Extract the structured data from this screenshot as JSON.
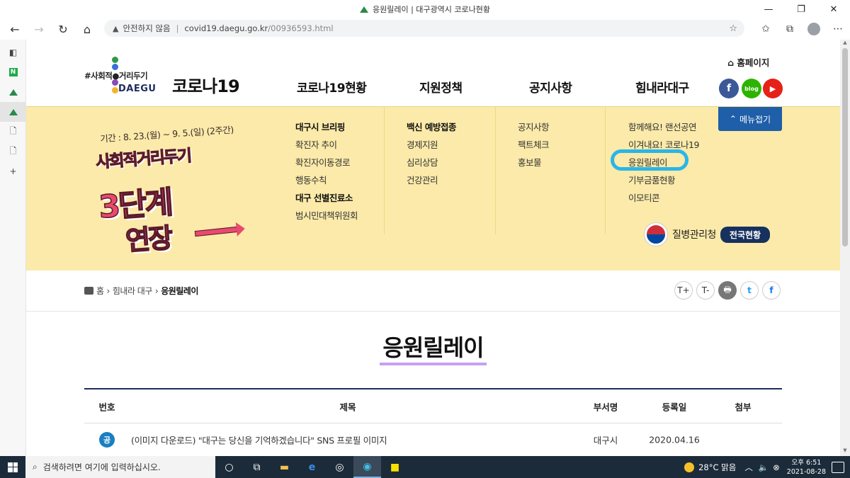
{
  "browser": {
    "window_title": "응원릴레이 | 대구광역시 코로나현황",
    "security_label": "안전하지 않음",
    "url_domain": "covid19.daegu.go.kr",
    "url_path": "/00936593.html"
  },
  "header": {
    "logo_tag": "#사회적●거리두기",
    "logo_sub": "DAEGU",
    "site_title": "코로나19",
    "gnb": [
      "코로나19현황",
      "지원정책",
      "공지사항",
      "힘내라대구"
    ],
    "homepage_label": "홈페이지",
    "sns": [
      "f",
      "blog",
      "▶"
    ]
  },
  "banner": {
    "period": "기간 : 8. 23.(월) ~ 9. 5.(일) (2주간)",
    "line1": "사회적거리두기",
    "line2": "3단계",
    "line3": "연장"
  },
  "mega_menu": {
    "col1": [
      {
        "label": "대구시 브리핑",
        "bold": true
      },
      {
        "label": "확진자 추이",
        "bold": false
      },
      {
        "label": "확진자이동경로",
        "bold": false
      },
      {
        "label": "행동수칙",
        "bold": false
      },
      {
        "label": "대구 선별진료소",
        "bold": true
      },
      {
        "label": "범시민대책위원회",
        "bold": false
      }
    ],
    "col2": [
      {
        "label": "백신 예방접종",
        "bold": true
      },
      {
        "label": "경제지원",
        "bold": false
      },
      {
        "label": "심리상담",
        "bold": false
      },
      {
        "label": "건강관리",
        "bold": false
      }
    ],
    "col3": [
      {
        "label": "공지사항",
        "bold": false
      },
      {
        "label": "팩트체크",
        "bold": false
      },
      {
        "label": "홍보물",
        "bold": false
      }
    ],
    "col4": [
      {
        "label": "함께해요! 랜선공연",
        "bold": false
      },
      {
        "label": "이겨내요! 코로나19",
        "bold": false
      },
      {
        "label": "응원릴레이",
        "bold": false
      },
      {
        "label": "기부금품현황",
        "bold": false
      },
      {
        "label": "이모티콘",
        "bold": false
      }
    ],
    "fold_label": "메뉴접기",
    "kdca_name": "질병관리청",
    "national_label": "전국현황"
  },
  "breadcrumb": {
    "home": "홈",
    "parent": "힘내라 대구",
    "current": "응원릴레이"
  },
  "tools": [
    "T+",
    "T-",
    "🖶",
    "t",
    "f"
  ],
  "page_title": "응원릴레이",
  "table": {
    "headers": [
      "번호",
      "제목",
      "부서명",
      "등록일",
      "첨부"
    ],
    "rows": [
      {
        "badge": "공",
        "title": "(이미지 다운로드) \"대구는 당신을 기억하겠습니다\" SNS 프로필 이미지",
        "dept": "대구시",
        "date": "2020.04.16"
      }
    ]
  },
  "taskbar": {
    "search_placeholder": "검색하려면 여기에 입력하십시오.",
    "weather": "28°C 맑음",
    "time": "오후 6:51",
    "date": "2021-08-28"
  },
  "colors": {
    "menu_bg": "#fbeaa9",
    "fold_button": "#1f5ea8",
    "title_underline": "#c9a0f0",
    "highlight_stroke": "#29b6e8"
  }
}
